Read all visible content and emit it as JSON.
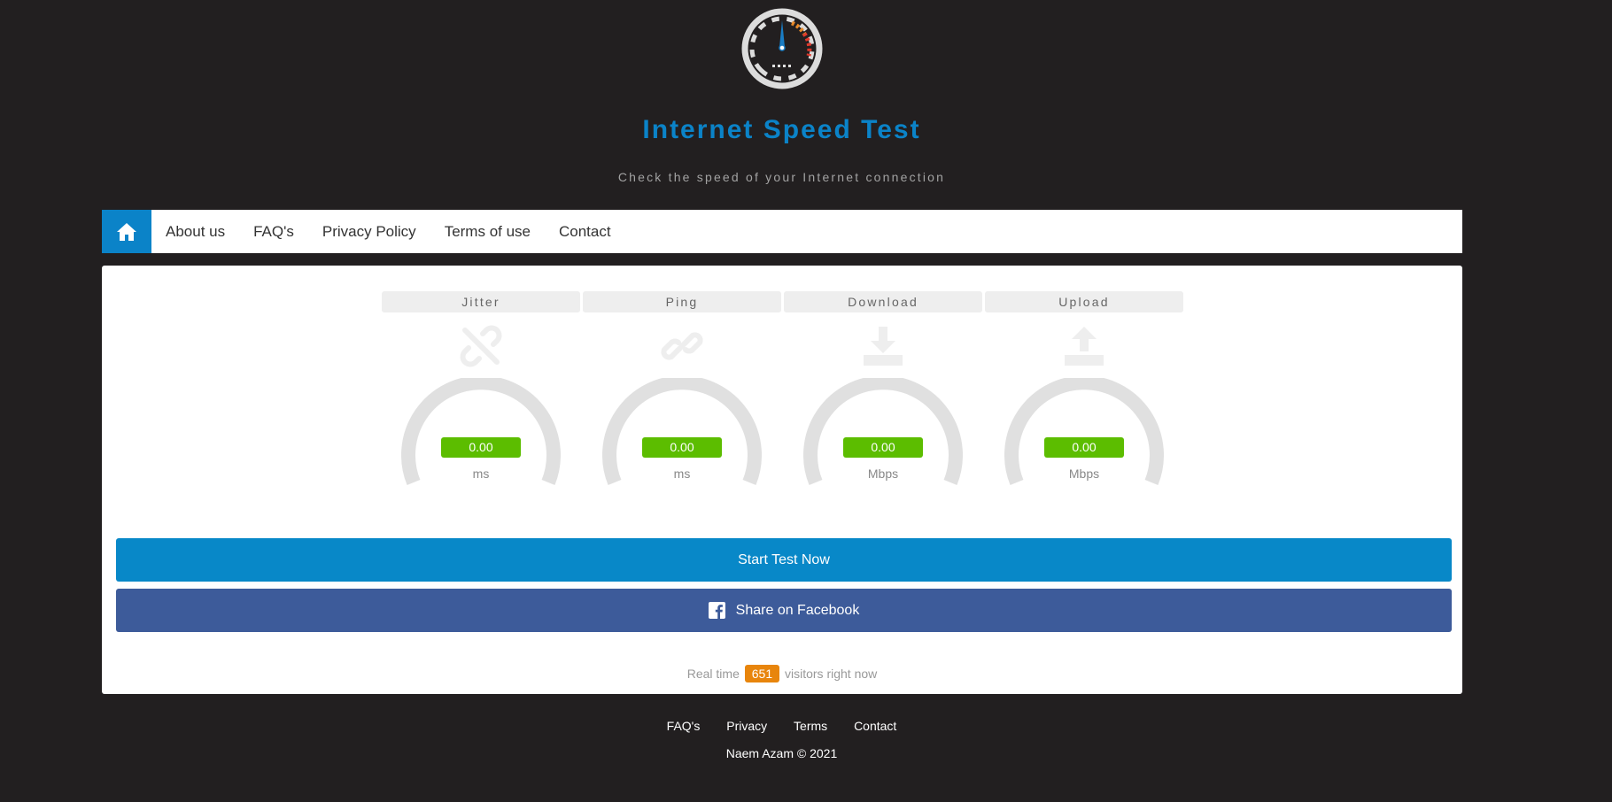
{
  "header": {
    "title": "Internet Speed Test",
    "subtitle": "Check the speed of your Internet connection",
    "logo_icon": "speedometer-icon"
  },
  "nav": {
    "home_icon": "home-icon",
    "items": [
      {
        "label": "About us"
      },
      {
        "label": "FAQ's"
      },
      {
        "label": "Privacy Policy"
      },
      {
        "label": "Terms of use"
      },
      {
        "label": "Contact"
      }
    ]
  },
  "meters": [
    {
      "label": "Jitter",
      "icon": "broken-link-icon",
      "value": "0.00",
      "unit": "ms"
    },
    {
      "label": "Ping",
      "icon": "link-icon",
      "value": "0.00",
      "unit": "ms"
    },
    {
      "label": "Download",
      "icon": "download-icon",
      "value": "0.00",
      "unit": "Mbps"
    },
    {
      "label": "Upload",
      "icon": "upload-icon",
      "value": "0.00",
      "unit": "Mbps"
    }
  ],
  "actions": {
    "start_label": "Start Test Now",
    "facebook_label": "Share on Facebook",
    "facebook_icon": "facebook-icon"
  },
  "visitors": {
    "prefix": "Real time",
    "count": "651",
    "suffix": "visitors right now"
  },
  "footer": {
    "links": [
      {
        "label": "FAQ's"
      },
      {
        "label": "Privacy"
      },
      {
        "label": "Terms"
      },
      {
        "label": "Contact"
      }
    ],
    "copyright": "Naem Azam © 2021"
  },
  "colors": {
    "background": "#221f20",
    "accent": "#0b83c8",
    "value_badge": "#5cbd00",
    "facebook": "#3d5b9a",
    "visitor_badge": "#e8850c"
  }
}
